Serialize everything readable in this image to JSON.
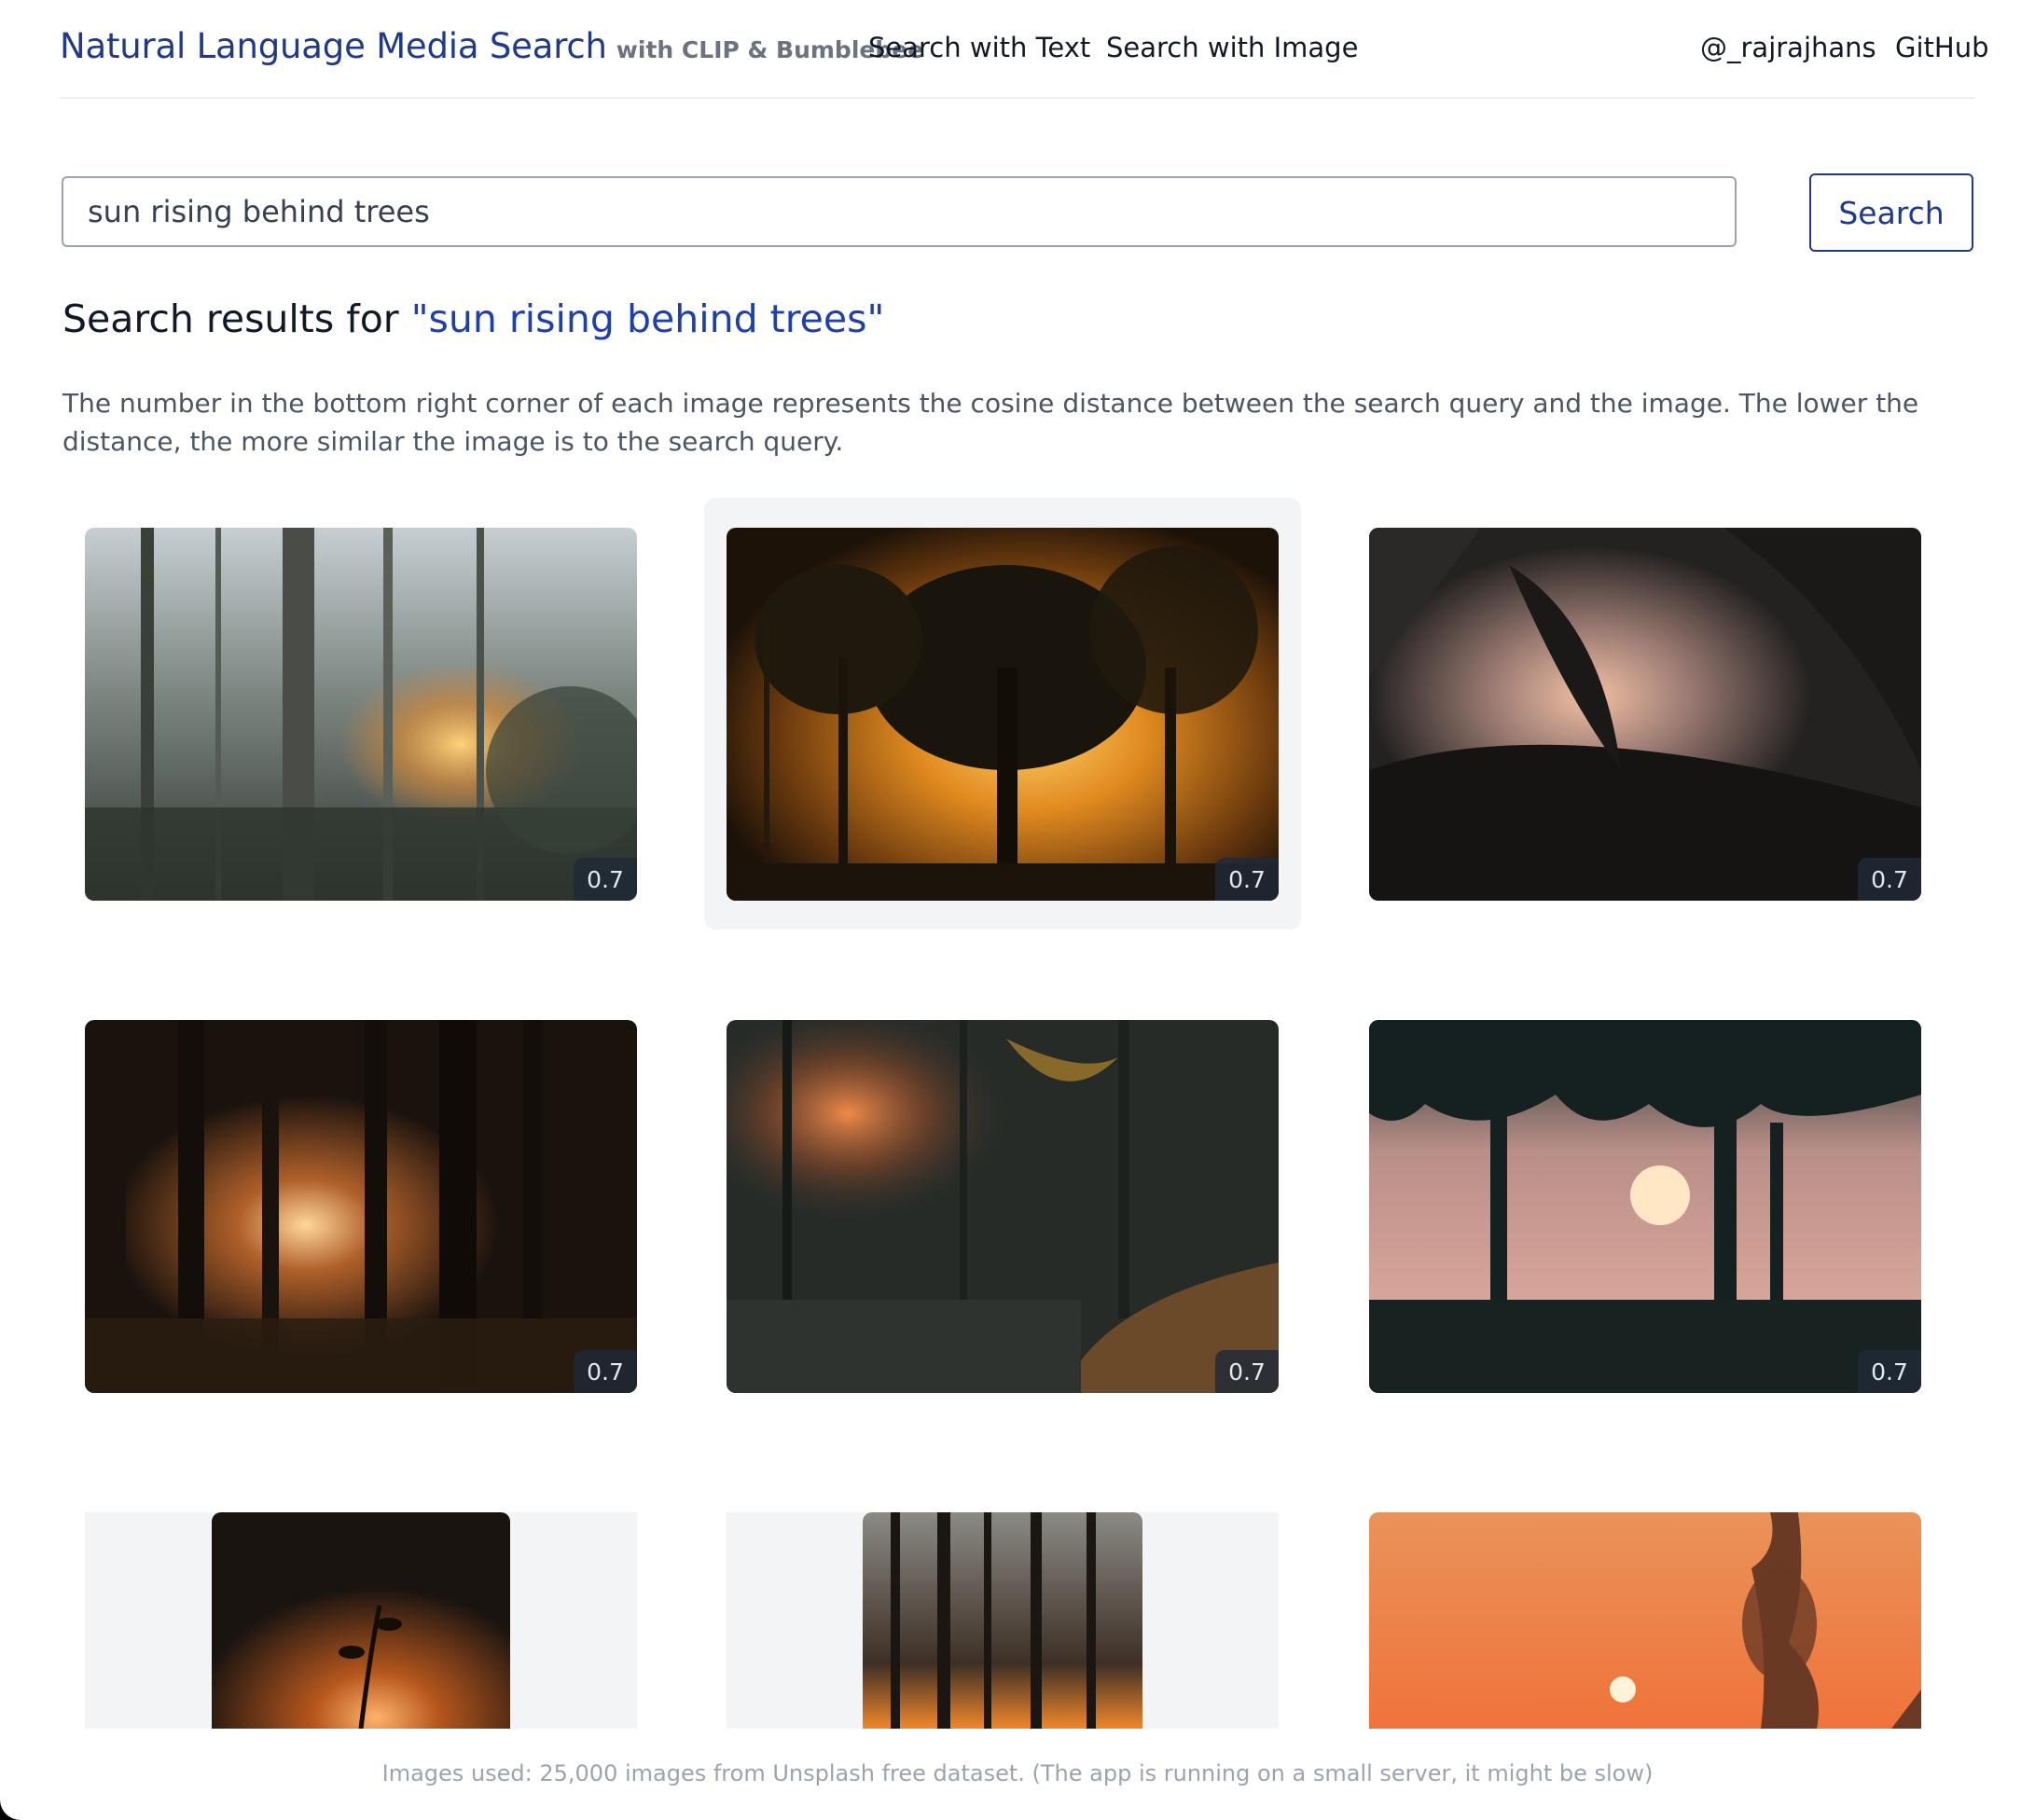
{
  "header": {
    "brand_title": "Natural Language Media Search",
    "brand_subtitle": "with CLIP & Bumblebee",
    "nav": {
      "search_text": "Search with Text",
      "search_image": "Search with Image",
      "author": "@_rajrajhans",
      "github": "GitHub"
    }
  },
  "search": {
    "query": "sun rising behind trees",
    "button_label": "Search"
  },
  "results": {
    "heading_prefix": "Search results for ",
    "heading_query": "\"sun rising behind trees\"",
    "description": "The number in the bottom right corner of each image represents the cosine distance between the search query and the image. The lower the distance, the more similar the image is to the search query.",
    "items": [
      {
        "score": "0.7"
      },
      {
        "score": "0.7"
      },
      {
        "score": "0.7"
      },
      {
        "score": "0.7"
      },
      {
        "score": "0.7"
      },
      {
        "score": "0.7"
      }
    ]
  },
  "footer": {
    "note": "Images used: 25,000 images from Unsplash free dataset. (The app is running on a small server, it might be slow)"
  },
  "colors": {
    "brand": "#1e3a8a",
    "query_accent": "#1e40af",
    "score_badge": "#1f2937"
  }
}
